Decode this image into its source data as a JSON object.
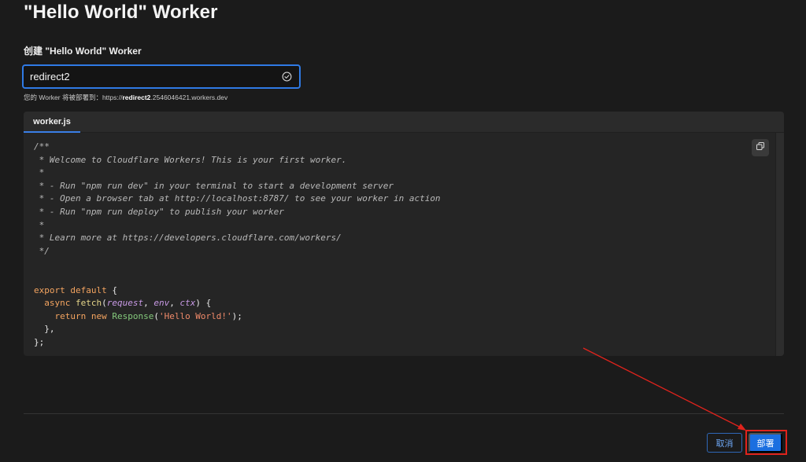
{
  "page": {
    "title": "\"Hello World\" Worker"
  },
  "form": {
    "label": "创建 \"Hello World\" Worker",
    "name_value": "redirect2",
    "hint_prefix": "您的 Worker 将被部署到：https://",
    "hint_name": "redirect2",
    "hint_suffix": ".2546046421.workers.dev"
  },
  "editor": {
    "tab_label": "worker.js",
    "code_lines": [
      [
        {
          "t": "/**",
          "c": "cm"
        }
      ],
      [
        {
          "t": " * Welcome to Cloudflare Workers! This is your first worker.",
          "c": "cm"
        }
      ],
      [
        {
          "t": " *",
          "c": "cm"
        }
      ],
      [
        {
          "t": " * - Run \"npm run dev\" in your terminal to start a development server",
          "c": "cm"
        }
      ],
      [
        {
          "t": " * - Open a browser tab at http://localhost:8787/ to see your worker in action",
          "c": "cm"
        }
      ],
      [
        {
          "t": " * - Run \"npm run deploy\" to publish your worker",
          "c": "cm"
        }
      ],
      [
        {
          "t": " *",
          "c": "cm"
        }
      ],
      [
        {
          "t": " * Learn more at https://developers.cloudflare.com/workers/",
          "c": "cm"
        }
      ],
      [
        {
          "t": " */",
          "c": "cm"
        }
      ],
      [],
      [],
      [
        {
          "t": "export default",
          "c": "kw"
        },
        {
          "t": " {",
          "c": "pl"
        }
      ],
      [
        {
          "t": "  async ",
          "c": "kw"
        },
        {
          "t": "fetch",
          "c": "fn"
        },
        {
          "t": "(",
          "c": "pl"
        },
        {
          "t": "request",
          "c": "pr"
        },
        {
          "t": ", ",
          "c": "pl"
        },
        {
          "t": "env",
          "c": "pr"
        },
        {
          "t": ", ",
          "c": "pl"
        },
        {
          "t": "ctx",
          "c": "pr"
        },
        {
          "t": ") {",
          "c": "pl"
        }
      ],
      [
        {
          "t": "    return new ",
          "c": "kw"
        },
        {
          "t": "Response",
          "c": "cl"
        },
        {
          "t": "(",
          "c": "pl"
        },
        {
          "t": "'Hello World!'",
          "c": "st"
        },
        {
          "t": ");",
          "c": "pl"
        }
      ],
      [
        {
          "t": "  },",
          "c": "pl"
        }
      ],
      [
        {
          "t": "};",
          "c": "pl"
        }
      ]
    ]
  },
  "icons": {
    "check": "check-circle-icon",
    "copy": "copy-icon"
  },
  "footer": {
    "cancel_label": "取消",
    "deploy_label": "部署"
  },
  "colors": {
    "accent": "#1b6fe0",
    "highlight": "#e0231c",
    "background": "#1b1b1b"
  }
}
